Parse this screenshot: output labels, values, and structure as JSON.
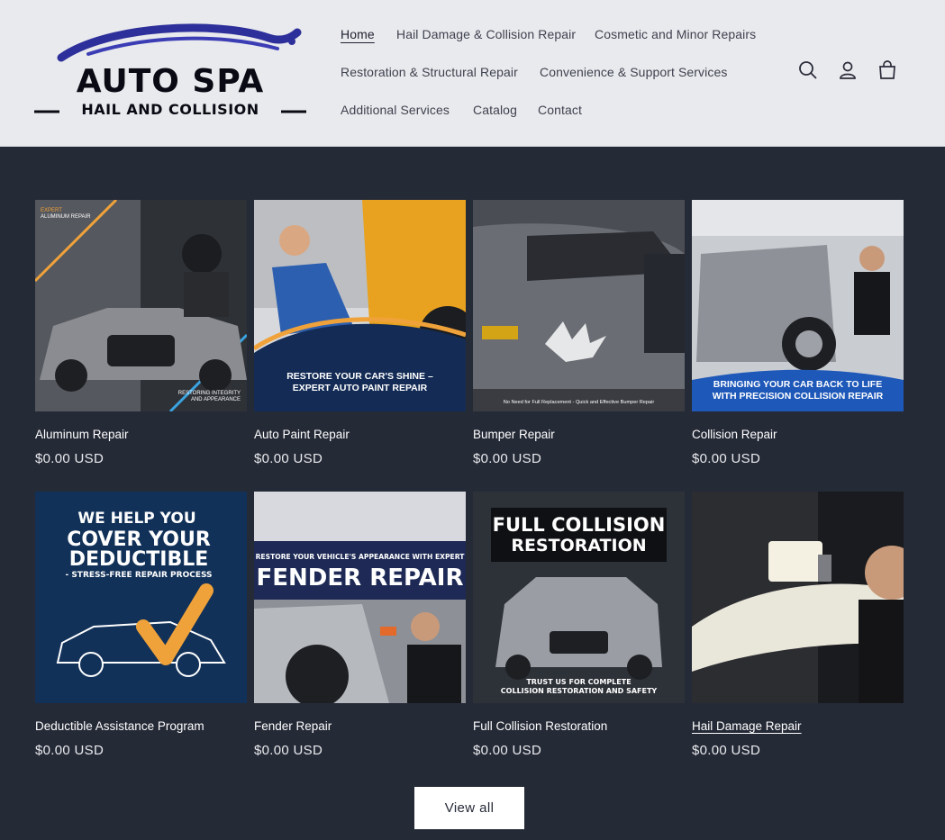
{
  "header": {
    "logo": {
      "main": "AUTO SPA",
      "sub": "HAIL AND COLLISION"
    },
    "nav": [
      {
        "label": "Home",
        "active": true
      },
      {
        "label": "Hail Damage & Collision Repair"
      },
      {
        "label": "Cosmetic and Minor Repairs"
      },
      {
        "label": "Restoration & Structural Repair"
      },
      {
        "label": "Convenience & Support Services"
      },
      {
        "label": "Additional Services"
      },
      {
        "label": "Catalog"
      },
      {
        "label": "Contact"
      }
    ],
    "icons": [
      "search-icon",
      "account-icon",
      "cart-icon"
    ]
  },
  "products": [
    {
      "title": "Aluminum Repair",
      "price": "$0.00 USD",
      "image_text": [
        "EXPERT",
        "ALUMINUM REPAIR",
        "RESTORING INTEGRITY",
        "AND APPEARANCE"
      ]
    },
    {
      "title": "Auto Paint Repair",
      "price": "$0.00 USD",
      "image_text": [
        "RESTORE YOUR CAR'S SHINE –",
        "EXPERT AUTO PAINT REPAIR"
      ]
    },
    {
      "title": "Bumper Repair",
      "price": "$0.00 USD",
      "image_text": [
        "No Need for Full Replacement - Quick and Effective Bumper Repair"
      ]
    },
    {
      "title": "Collision Repair",
      "price": "$0.00 USD",
      "image_text": [
        "BRINGING YOUR CAR BACK TO LIFE",
        "WITH PRECISION COLLISION REPAIR"
      ]
    },
    {
      "title": "Deductible Assistance Program",
      "price": "$0.00 USD",
      "image_text": [
        "WE HELP YOU",
        "COVER YOUR",
        "DEDUCTIBLE",
        "- STRESS-FREE REPAIR PROCESS"
      ]
    },
    {
      "title": "Fender Repair",
      "price": "$0.00 USD",
      "image_text": [
        "RESTORE YOUR VEHICLE'S APPEARANCE WITH EXPERT",
        "FENDER REPAIR"
      ]
    },
    {
      "title": "Full Collision Restoration",
      "price": "$0.00 USD",
      "image_text": [
        "FULL COLLISION",
        "RESTORATION",
        "TRUST US FOR COMPLETE",
        "COLLISION RESTORATION AND SAFETY"
      ]
    },
    {
      "title": "Hail Damage Repair",
      "price": "$0.00 USD",
      "image_text": []
    }
  ],
  "view_all_label": "View all",
  "colors": {
    "background": "#252a37",
    "header": "#e9eaed",
    "accent_orange": "#f0a23a",
    "deep_navy": "#142c55"
  }
}
